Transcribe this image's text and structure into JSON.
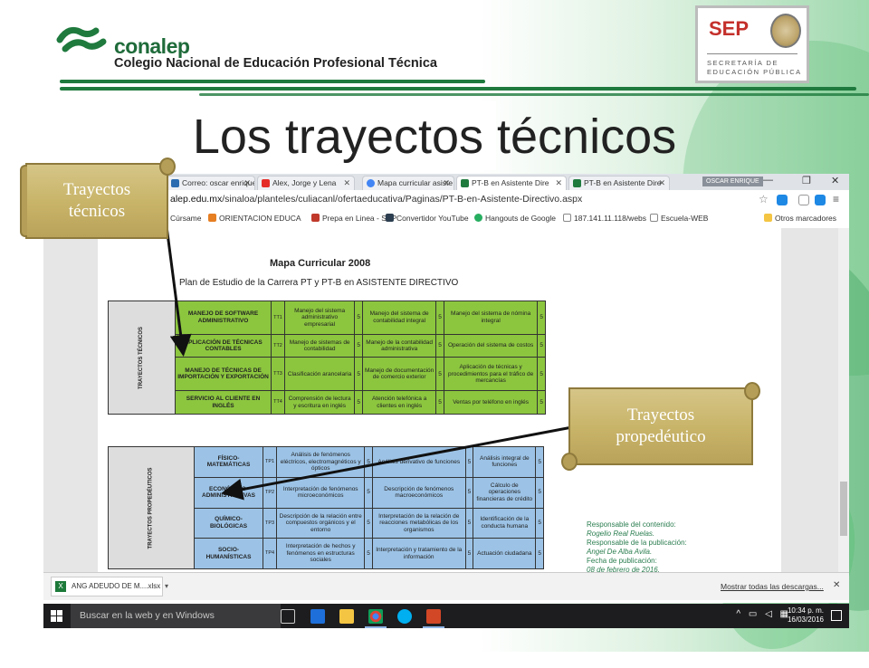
{
  "header": {
    "brand_short": "conalep",
    "brand_full": "Colegio Nacional de Educación Profesional Técnica",
    "sep_title": "SEP",
    "sep_line1": "SECRETARÍA DE",
    "sep_line2": "EDUCACIÓN PÚBLICA"
  },
  "slide_title": "Los trayectos técnicos",
  "browser": {
    "tabs": [
      {
        "label": "Correo: oscar enrique",
        "active": false
      },
      {
        "label": "Alex, Jorge y Lena",
        "active": false
      },
      {
        "label": "Mapa curricular asiste",
        "active": false
      },
      {
        "label": "PT-B en Asistente Dire",
        "active": true
      },
      {
        "label": "PT-B en Asistente Dire",
        "active": false
      }
    ],
    "user_badge": "OSCAR ENRIQUE",
    "url_prefix": "alep.edu.mx",
    "url_path": "/sinaloa/planteles/culiacanl/ofertaeducativa/Paginas/PT-B-en-Asistente-Directivo.aspx",
    "bookmarks": [
      "Cúrsame",
      "ORIENTACION EDUCA",
      "Prepa en Linea - SEP",
      "Convertidor YouTube",
      "Hangouts de Google",
      "187.141.11.118/webs",
      "Escuela-WEB"
    ],
    "other_bookmarks": "Otros marcadores"
  },
  "mapa": {
    "title": "Mapa Curricular 2008",
    "subtitle": "Plan de Estudio de la Carrera PT y PT-B en ASISTENTE DIRECTIVO",
    "tecnicos_label": "TRAYECTOS TÉCNICOS",
    "tecnicos_rows": [
      {
        "name": "MANEJO DE SOFTWARE ADMINISTRATIVO",
        "code": "TT1",
        "c1": "Manejo del sistema administrativo empresarial",
        "n1": "5",
        "c2": "Manejo del sistema de contabilidad integral",
        "n2": "5",
        "c3": "Manejo del sistema de nómina integral",
        "n3": "5"
      },
      {
        "name": "APLICACIÓN DE TÉCNICAS CONTABLES",
        "code": "TT2",
        "c1": "Manejo de sistemas de contabilidad",
        "n1": "5",
        "c2": "Manejo de la contabilidad administrativa",
        "n2": "5",
        "c3": "Operación del sistema de costos",
        "n3": "5"
      },
      {
        "name": "MANEJO DE TÉCNICAS DE IMPORTACIÓN Y EXPORTACIÓN",
        "code": "TT3",
        "c1": "Clasificación arancelaria",
        "n1": "5",
        "c2": "Manejo de documentación de comercio exterior",
        "n2": "5",
        "c3": "Aplicación de técnicas y procedimientos para el tráfico de mercancías",
        "n3": "5"
      },
      {
        "name": "SERVICIO AL CLIENTE EN INGLÉS",
        "code": "TT4",
        "c1": "Comprensión de lectura y escritura en inglés",
        "n1": "5",
        "c2": "Atención telefónica a clientes en inglés",
        "n2": "5",
        "c3": "Ventas por teléfono en inglés",
        "n3": "5"
      }
    ],
    "propedeuticos_label": "TRAYECTOS PROPEDÉUTICOS",
    "propedeuticos_rows": [
      {
        "name": "FÍSICO-MATEMÁTICAS",
        "code": "TP1",
        "c1": "Análisis de fenómenos eléctricos, electromagnéticos y ópticos",
        "n1": "5",
        "c2": "Análisis derivativo de funciones",
        "n2": "5",
        "c3": "Análisis integral de funciones",
        "n3": "5"
      },
      {
        "name": "ECONÓMICO-ADMINISTRATIVAS",
        "code": "TP2",
        "c1": "Interpretación de fenómenos microeconómicos",
        "n1": "5",
        "c2": "Descripción de fenómenos macroeconómicos",
        "n2": "5",
        "c3": "Cálculo de operaciones financieras de crédito",
        "n3": "5"
      },
      {
        "name": "QUÍMICO-BIOLÓGICAS",
        "code": "TP3",
        "c1": "Descripción de la relación entre compuestos orgánicos y el entorno",
        "n1": "5",
        "c2": "Interpretación de la relación de reacciones metabólicas de los organismos",
        "n2": "5",
        "c3": "Identificación de la conducta humana",
        "n3": "5"
      },
      {
        "name": "SOCIO-HUMANÍSTICAS",
        "code": "TP4",
        "c1": "Interpretación de hechos y fenómenos en estructuras sociales",
        "n1": "5",
        "c2": "Interpretación y tratamiento de la información",
        "n2": "5",
        "c3": "Actuación ciudadana",
        "n3": "5"
      }
    ],
    "resp": {
      "l1": "Responsable del contenido:",
      "l2": "Rogelio Real Ruelas.",
      "l3": "Responsable de la publicación:",
      "l4": "Angel De Alba Avila.",
      "l5": "Fecha de publicación:",
      "l6": "08 de febrero de 2016."
    }
  },
  "download_bar": {
    "file": "ANG ADEUDO DE M....xlsx",
    "show_all": "Mostrar todas las descargas..."
  },
  "taskbar": {
    "search_placeholder": "Buscar en la web y en Windows",
    "time": "10:34 p. m.",
    "date": "16/03/2016"
  },
  "callouts": {
    "tecnicos": "Trayectos técnicos",
    "propedeutico": "Trayectos propedéutico"
  }
}
